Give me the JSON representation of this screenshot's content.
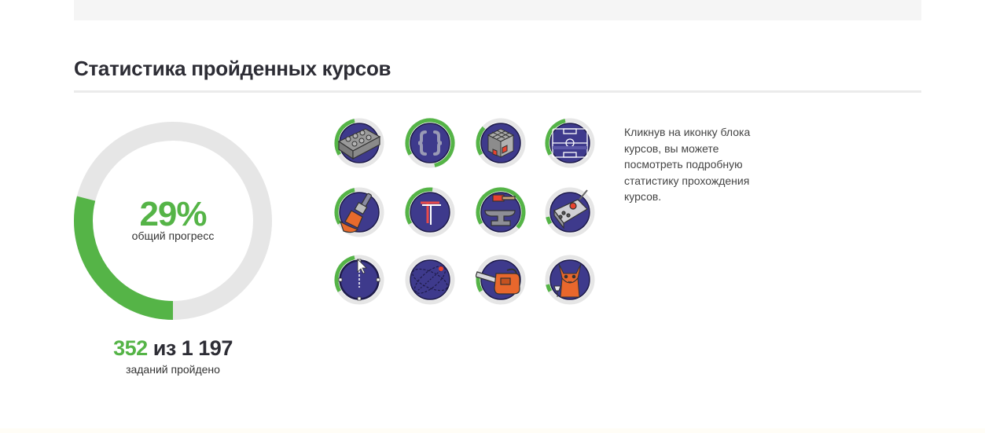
{
  "section": {
    "title": "Статистика пройденных курсов"
  },
  "overall": {
    "percent_text": "29%",
    "progress": 0.29,
    "caption": "общий прогресс",
    "tasks_done": "352",
    "tasks_separator": "из",
    "tasks_total": "1 197",
    "tasks_caption": "заданий пройдено"
  },
  "hint": {
    "lines": [
      "Кликнув на иконку блока",
      "курсов, вы можете",
      "посмотреть подробную",
      "статистику прохождения",
      "курсов."
    ]
  },
  "colors": {
    "accent": "#55b447",
    "track": "#e6e6e6",
    "icon_bg": "#3e3a8c",
    "title": "#2d2d35"
  },
  "course_blocks": [
    {
      "icon": "lego-brick-icon",
      "progress": 0.3
    },
    {
      "icon": "curly-braces-icon",
      "progress": 0.8
    },
    {
      "icon": "rubiks-cube-icon",
      "progress": 0.2
    },
    {
      "icon": "football-field-icon",
      "progress": 0.3
    },
    {
      "icon": "paintbrush-icon",
      "progress": 0.3
    },
    {
      "icon": "letter-t-icon",
      "progress": 0.35
    },
    {
      "icon": "anvil-hammer-icon",
      "progress": 0.7
    },
    {
      "icon": "remote-control-icon",
      "progress": 0.05
    },
    {
      "icon": "vector-cursor-icon",
      "progress": 0.3
    },
    {
      "icon": "orbit-sphere-icon",
      "progress": 0.0
    },
    {
      "icon": "chainsaw-icon",
      "progress": 0.1
    },
    {
      "icon": "fox-with-glass-icon",
      "progress": 0.05
    }
  ]
}
